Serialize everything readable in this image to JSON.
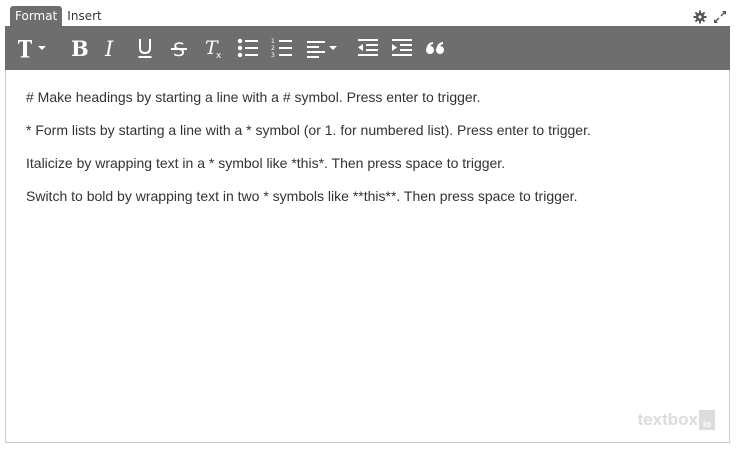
{
  "tabs": [
    {
      "label": "Format",
      "active": true
    },
    {
      "label": "Insert",
      "active": false
    }
  ],
  "top_icons": [
    "gear-icon",
    "expand-icon"
  ],
  "toolbar": {
    "buttons": [
      "text-style-icon",
      "bold-icon",
      "italic-icon",
      "underline-icon",
      "strikethrough-icon",
      "clear-formatting-icon",
      "bulleted-list-icon",
      "numbered-list-icon",
      "align-icon",
      "outdent-icon",
      "indent-icon",
      "blockquote-icon"
    ]
  },
  "editor": {
    "paragraphs": [
      "# Make headings by starting a line with a # symbol. Press enter to trigger.",
      "* Form lists by starting a line with a * symbol (or 1. for numbered list). Press enter to trigger.",
      "Italicize by wrapping text in a * symbol like *this*. Then press space to trigger.",
      "Switch to bold by wrapping text in two * symbols like **this**. Then press space to trigger."
    ]
  },
  "branding": {
    "text": "textbox",
    "box_text": "io"
  },
  "colors": {
    "toolbar_bg": "#6e6e6e",
    "toolbar_icon": "#ffffff",
    "border": "#c9c9c9",
    "brand": "#dcdcdc"
  }
}
